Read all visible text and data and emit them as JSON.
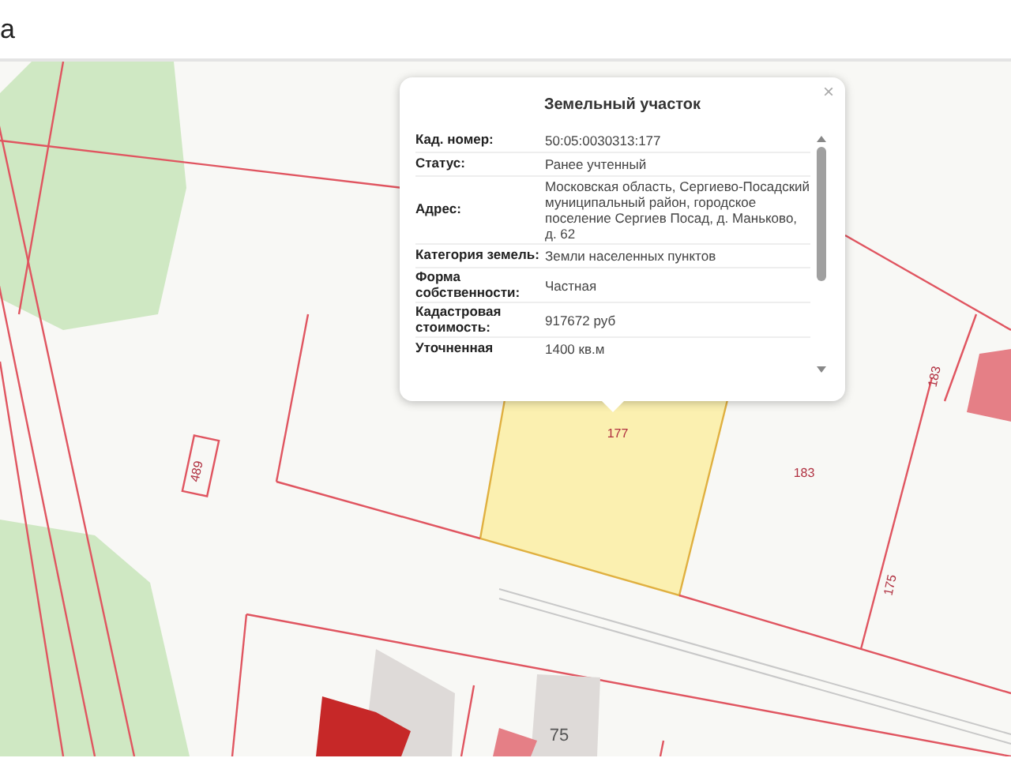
{
  "header": {
    "title": "а"
  },
  "map": {
    "labels": [
      "489",
      "177",
      "183",
      "175",
      "183",
      "75"
    ]
  },
  "popup": {
    "title": "Земельный участок",
    "close": "×",
    "rows": [
      {
        "label": "Кад. номер:",
        "value": "50:05:0030313:177"
      },
      {
        "label": "Статус:",
        "value": "Ранее учтенный"
      },
      {
        "label": "Адрес:",
        "value": "Московская область, Сергиево-Посадский муниципальный район, городское поселение Сергиев Посад, д. Маньково, д. 62"
      },
      {
        "label": "Категория земель:",
        "value": "Земли населенных пунктов"
      },
      {
        "label": "Форма собственности:",
        "value": "Частная"
      },
      {
        "label": "Кадастровая стоимость:",
        "value": "917672 руб"
      },
      {
        "label": "Уточненная",
        "value": "1400 кв.м"
      }
    ]
  }
}
